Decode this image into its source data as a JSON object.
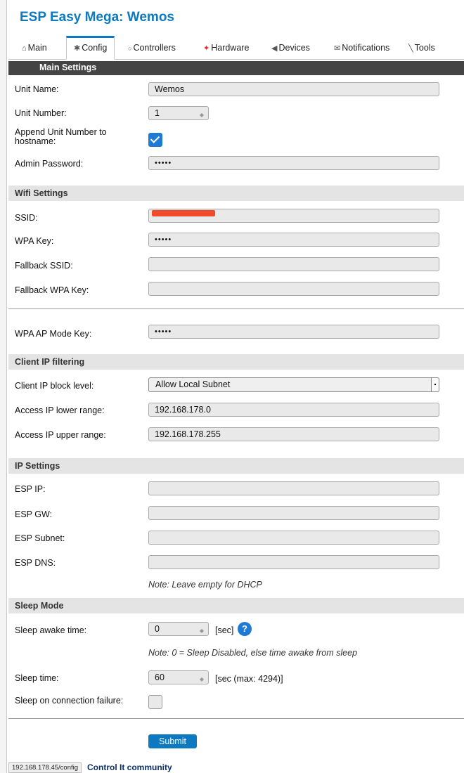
{
  "app": {
    "title": "ESP Easy Mega: Wemos"
  },
  "tabs": [
    {
      "icon": "home-icon",
      "glyph": "⌂",
      "label": "Main"
    },
    {
      "icon": "gear-icon",
      "glyph": "✱",
      "label": "Config",
      "active": true
    },
    {
      "icon": "chat-icon",
      "glyph": "💬",
      "label": "Controllers"
    },
    {
      "icon": "pushpin-icon",
      "glyph": "📌",
      "label": "Hardware"
    },
    {
      "icon": "plug-icon",
      "glyph": "🔌",
      "label": "Devices"
    },
    {
      "icon": "envelope-icon",
      "glyph": "✉",
      "label": "Notifications"
    },
    {
      "icon": "wrench-icon",
      "glyph": "🔧",
      "label": "Tools"
    }
  ],
  "main_settings": {
    "heading": "Main Settings",
    "unit_name_label": "Unit Name:",
    "unit_name_value": "Wemos",
    "unit_number_label": "Unit Number:",
    "unit_number_value": "1",
    "append_label_line1": "Append Unit Number to",
    "append_label_line2": "hostname:",
    "append_checked": true,
    "admin_password_label": "Admin Password:",
    "admin_password_value": "•••••"
  },
  "wifi": {
    "heading": "Wifi Settings",
    "ssid_label": "SSID:",
    "ssid_value": "",
    "wpa_key_label": "WPA Key:",
    "wpa_key_value": "•••••",
    "fallback_ssid_label": "Fallback SSID:",
    "fallback_ssid_value": "",
    "fallback_wpa_label": "Fallback WPA Key:",
    "fallback_wpa_value": "",
    "ap_key_label": "WPA AP Mode Key:",
    "ap_key_value": "•••••"
  },
  "client_ip": {
    "heading": "Client IP filtering",
    "block_level_label": "Client IP block level:",
    "block_level_value": "Allow Local Subnet",
    "lower_label": "Access IP lower range:",
    "lower_value": "192.168.178.0",
    "upper_label": "Access IP upper range:",
    "upper_value": "192.168.178.255"
  },
  "ip_settings": {
    "heading": "IP Settings",
    "esp_ip_label": "ESP IP:",
    "esp_gw_label": "ESP GW:",
    "esp_subnet_label": "ESP Subnet:",
    "esp_dns_label": "ESP DNS:",
    "note": "Note: Leave empty for DHCP"
  },
  "sleep": {
    "heading": "Sleep Mode",
    "awake_label": "Sleep awake time:",
    "awake_value": "0",
    "awake_unit": "[sec]",
    "help_glyph": "?",
    "note": "Note: 0 = Sleep Disabled, else time awake from sleep",
    "sleep_time_label": "Sleep time:",
    "sleep_time_value": "60",
    "sleep_time_unit": "[sec (max: 4294)]",
    "conn_fail_label": "Sleep on connection failure:",
    "conn_fail_checked": false
  },
  "actions": {
    "submit_label": "Submit"
  },
  "status": {
    "url": "192.168.178.45/config",
    "footer_link": "Control It community"
  },
  "colors": {
    "accent": "#0d79c0",
    "header_bar": "#444444",
    "section_bg": "#e4e4e4",
    "redaction": "#f04a2a"
  }
}
